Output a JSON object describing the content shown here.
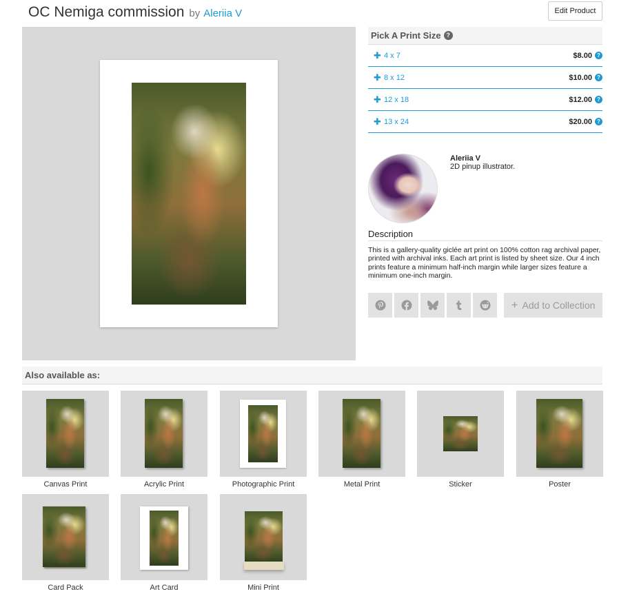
{
  "header": {
    "title": "OC Nemiga commission",
    "by": "by",
    "artist": "Aleriia V",
    "edit_button": "Edit Product"
  },
  "print_sizes": {
    "heading": "Pick A Print Size",
    "help_icon": "?",
    "options": [
      {
        "label": "4 x 7",
        "price": "$8.00"
      },
      {
        "label": "8 x 12",
        "price": "$10.00"
      },
      {
        "label": "12 x 18",
        "price": "$12.00"
      },
      {
        "label": "13 x 24",
        "price": "$20.00"
      }
    ]
  },
  "artist_card": {
    "name": "Aleriia V",
    "bio": "2D pinup illustrator."
  },
  "description": {
    "heading": "Description",
    "text": "This is a gallery-quality giclée art print on 100% cotton rag archival paper, printed with archival inks. Each art print is listed by sheet size. Our 4 inch prints feature a minimum half-inch margin while larger sizes feature a minimum one-inch margin."
  },
  "share": {
    "icons": [
      "pinterest-icon",
      "facebook-icon",
      "bluesky-icon",
      "tumblr-icon",
      "reddit-icon"
    ],
    "collection_label": "Add to Collection"
  },
  "also_available": {
    "heading": "Also available as:",
    "products": [
      "Canvas Print",
      "Acrylic Print",
      "Photographic Print",
      "Metal Print",
      "Sticker",
      "Poster",
      "Card Pack",
      "Art Card",
      "Mini Print"
    ]
  },
  "colors": {
    "accent": "#1a9ad6",
    "tile_bg": "#d9d9d9",
    "button_bg": "#e2e2e2"
  }
}
